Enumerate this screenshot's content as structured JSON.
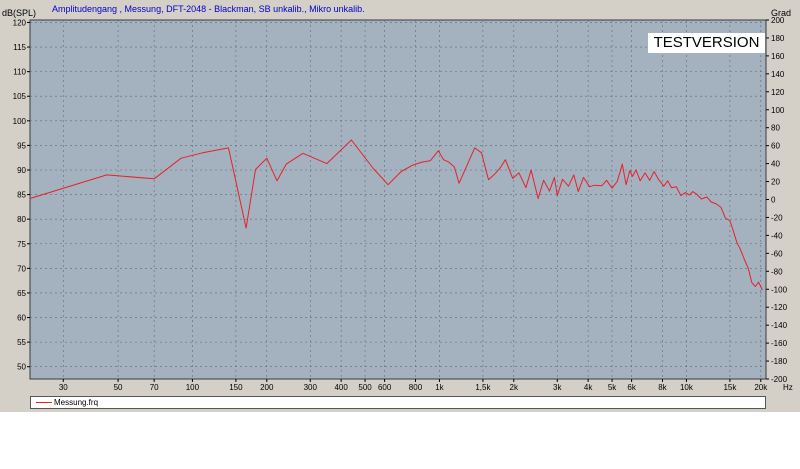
{
  "chart_data": {
    "type": "line",
    "title": "Amplitudengang , Messung, DFT-2048 - Blackman, SB unkalib., Mikro unkalib.",
    "ylabel": "dB(SPL)",
    "y2label": "Grad",
    "xlabel": "Hz",
    "xscale": "log",
    "xlim": [
      22,
      21000
    ],
    "ylim": [
      47.5,
      120.5
    ],
    "y2lim": [
      -200,
      200
    ],
    "grid": true,
    "watermark": "TESTVERSION",
    "x_ticks": [
      30,
      50,
      70,
      100,
      150,
      200,
      300,
      400,
      500,
      600,
      800,
      1000,
      1500,
      2000,
      3000,
      4000,
      5000,
      6000,
      8000,
      10000,
      15000,
      20000
    ],
    "x_tick_labels": [
      "30",
      "50",
      "70",
      "100",
      "150",
      "200",
      "300",
      "400",
      "500",
      "600",
      "800",
      "1k",
      "1,5k",
      "2k",
      "3k",
      "4k",
      "5k",
      "6k",
      "8k",
      "10k",
      "15k",
      "20k"
    ],
    "y_ticks": [
      50,
      55,
      60,
      65,
      70,
      75,
      80,
      85,
      90,
      95,
      100,
      105,
      110,
      115,
      120
    ],
    "y_tick_labels": [
      "50",
      "55",
      "60",
      "65",
      "70",
      "75",
      "80",
      "85",
      "90",
      "95",
      "100",
      "105",
      "110",
      "115",
      "120"
    ],
    "y2_ticks": [
      200,
      180,
      160,
      140,
      120,
      100,
      80,
      60,
      40,
      20,
      0,
      -20,
      -40,
      -60,
      -80,
      -100,
      -120,
      -140,
      -160,
      -180,
      -200
    ],
    "y2_tick_labels": [
      "200",
      "180",
      "160",
      "140",
      "120",
      "100",
      "80",
      "60",
      "40",
      "20",
      "0",
      "-20",
      "-40",
      "-60",
      "-80",
      "-100",
      "-120",
      "-140",
      "-160",
      "-180",
      "-200"
    ],
    "legend_placement": "bottom",
    "series": [
      {
        "name": "Messung.frq",
        "color": "#e8202a",
        "x": [
          22,
          45,
          70,
          90,
          110,
          140,
          165,
          180,
          200,
          220,
          240,
          280,
          350,
          440,
          540,
          620,
          700,
          780,
          850,
          920,
          990,
          1040,
          1090,
          1150,
          1200,
          1290,
          1390,
          1480,
          1580,
          1670,
          1760,
          1850,
          1980,
          2100,
          2240,
          2350,
          2510,
          2640,
          2790,
          2920,
          3000,
          3150,
          3330,
          3500,
          3650,
          3830,
          4050,
          4250,
          4550,
          4750,
          5000,
          5250,
          5500,
          5700,
          5900,
          6050,
          6250,
          6500,
          6800,
          7100,
          7400,
          7700,
          8100,
          8400,
          8700,
          9100,
          9500,
          9900,
          10300,
          10600,
          11000,
          11500,
          12100,
          12600,
          13200,
          13800,
          14400,
          15000,
          15400,
          16000,
          16500,
          17200,
          17800,
          18400,
          19000,
          19600,
          20300
        ],
        "values": [
          84.2,
          89,
          88.2,
          92.4,
          93.5,
          94.5,
          78.2,
          90.1,
          92.4,
          87.8,
          91.2,
          93.4,
          91.3,
          96.1,
          90.3,
          87,
          89.7,
          91,
          91.6,
          91.9,
          93.9,
          92.1,
          91.6,
          90.6,
          87.3,
          90.8,
          94.5,
          93.5,
          88,
          89.1,
          90.4,
          92.1,
          88.3,
          89.4,
          86.4,
          90,
          84.2,
          87.9,
          85.7,
          88.5,
          84.8,
          88.1,
          86.7,
          89,
          85.6,
          88.5,
          86.6,
          86.9,
          86.8,
          87.9,
          86.3,
          87.7,
          91.2,
          87,
          89.9,
          88.7,
          90,
          87.8,
          89.4,
          87.9,
          89.7,
          88.1,
          86.7,
          87.8,
          86.4,
          86.6,
          84.8,
          85.4,
          84.9,
          85.6,
          85.1,
          84.1,
          84.5,
          83.5,
          83.1,
          82.4,
          80.2,
          79.7,
          78,
          75.3,
          74,
          71.7,
          70,
          67.1,
          66.3,
          67.2,
          65.6
        ]
      }
    ]
  }
}
